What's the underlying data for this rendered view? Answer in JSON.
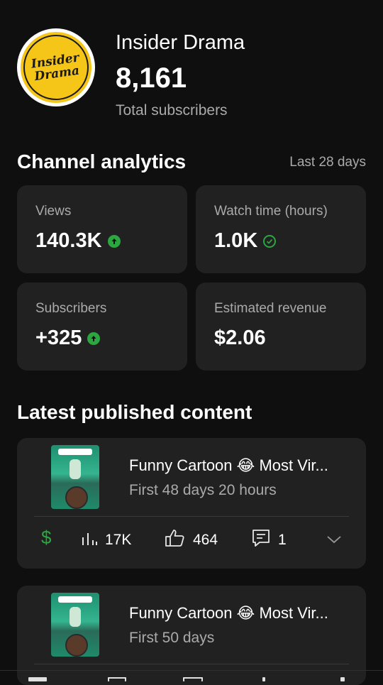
{
  "channel": {
    "avatar_text_line1": "Insider",
    "avatar_text_line2": "Drama",
    "name": "Insider Drama",
    "subscribers": "8,161",
    "subscribers_label": "Total subscribers"
  },
  "analytics": {
    "title": "Channel analytics",
    "period": "Last 28 days",
    "cards": [
      {
        "label": "Views",
        "value": "140.3K",
        "indicator": "up-arrow-icon"
      },
      {
        "label": "Watch time (hours)",
        "value": "1.0K",
        "indicator": "check-circle-icon"
      },
      {
        "label": "Subscribers",
        "value": "+325",
        "indicator": "up-arrow-icon"
      },
      {
        "label": "Estimated revenue",
        "value": "$2.06",
        "indicator": ""
      }
    ],
    "accent_color": "#2ba640"
  },
  "latest": {
    "title": "Latest published content",
    "items": [
      {
        "title": "Funny Cartoon 😂 Most Vir...",
        "meta": "First 48 days 20 hours",
        "views": "17K",
        "likes": "464",
        "comments": "1"
      },
      {
        "title": "Funny Cartoon 😂 Most Vir...",
        "meta": "First 50 days"
      }
    ]
  }
}
